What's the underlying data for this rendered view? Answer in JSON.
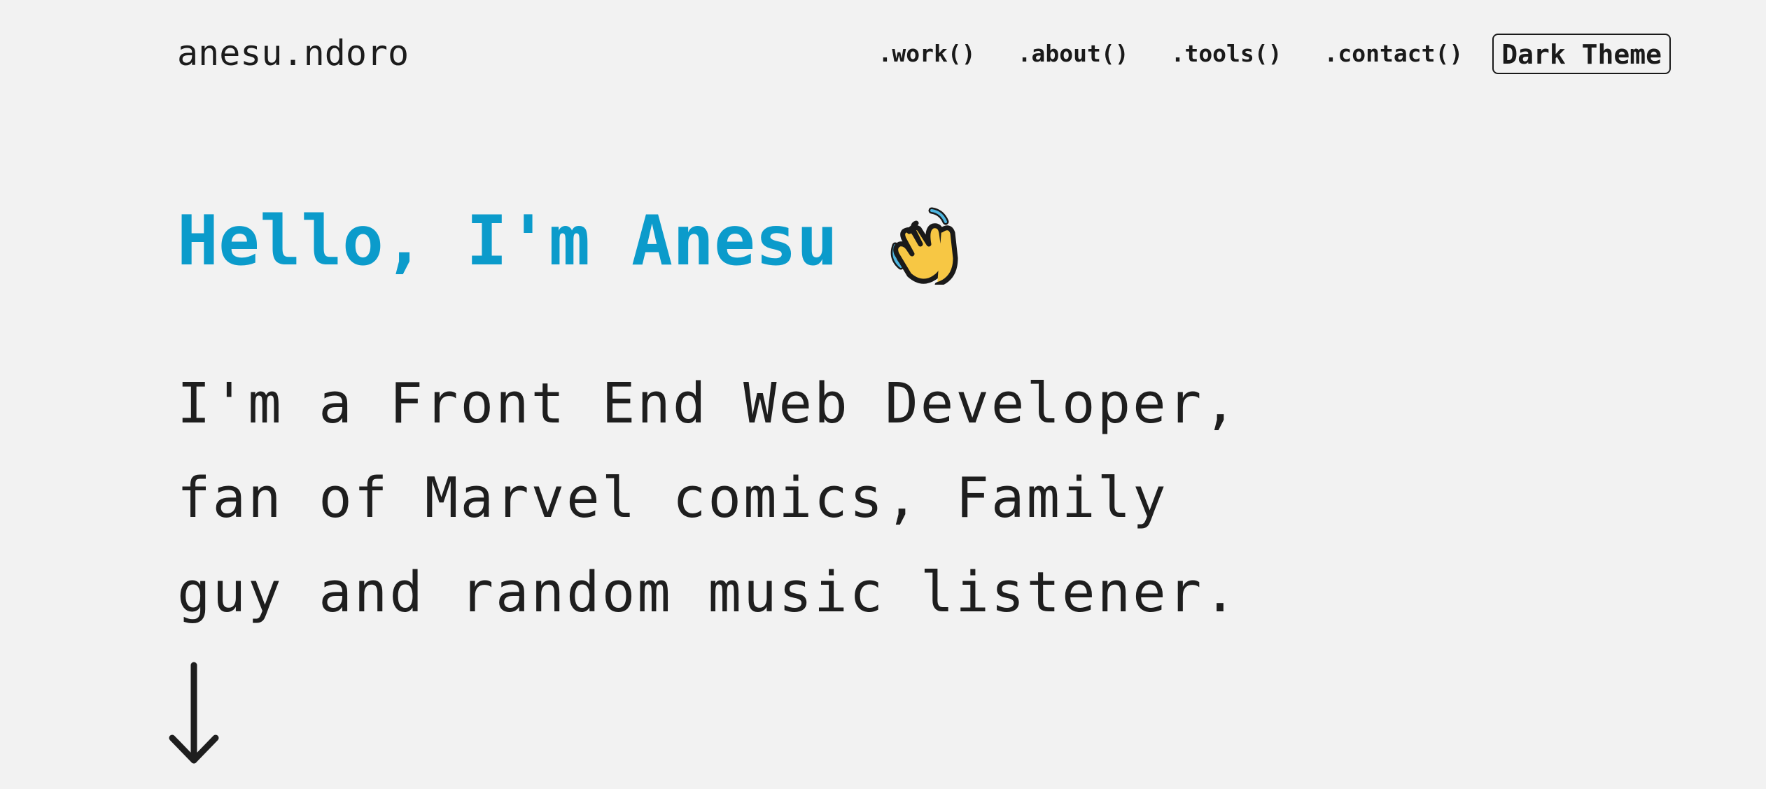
{
  "header": {
    "brand": "anesu.ndoro",
    "nav": [
      {
        "label": ".work()"
      },
      {
        "label": ".about()"
      },
      {
        "label": ".tools()"
      },
      {
        "label": ".contact()"
      }
    ],
    "theme_toggle_label": "Dark Theme"
  },
  "hero": {
    "title": "Hello, I'm Anesu",
    "wave_icon": "waving-hand-icon",
    "intro_lines": [
      "I'm a Front End Web Developer,",
      "fan of Marvel comics, Family",
      "guy and random music listener."
    ],
    "scroll_icon": "arrow-down-icon"
  },
  "colors": {
    "background": "#f2f2f2",
    "accent": "#0b9bcb",
    "text": "#1e1e1e"
  }
}
